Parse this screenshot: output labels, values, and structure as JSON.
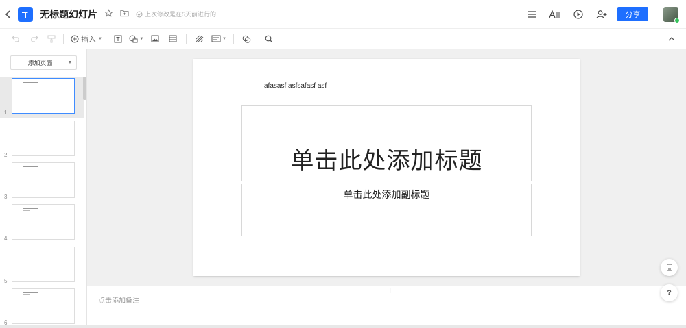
{
  "header": {
    "doc_title": "无标题幻灯片",
    "save_status": "上次修改是在5天前进行的",
    "share_label": "分享"
  },
  "toolbar": {
    "insert_label": "插入"
  },
  "sidebar": {
    "add_page_label": "添加页面",
    "slides": [
      {
        "number": "1"
      },
      {
        "number": "2"
      },
      {
        "number": "3"
      },
      {
        "number": "4"
      },
      {
        "number": "5"
      },
      {
        "number": "6"
      }
    ]
  },
  "slide": {
    "text": "afasasf asfsafasf asf",
    "title_placeholder": "单击此处添加标题",
    "subtitle_placeholder": "单击此处添加副标题"
  },
  "notes": {
    "placeholder": "点击添加备注"
  },
  "floating": {
    "help_label": "?"
  },
  "colors": {
    "accent": "#1e6fff",
    "selected_border": "#3f8cff"
  }
}
